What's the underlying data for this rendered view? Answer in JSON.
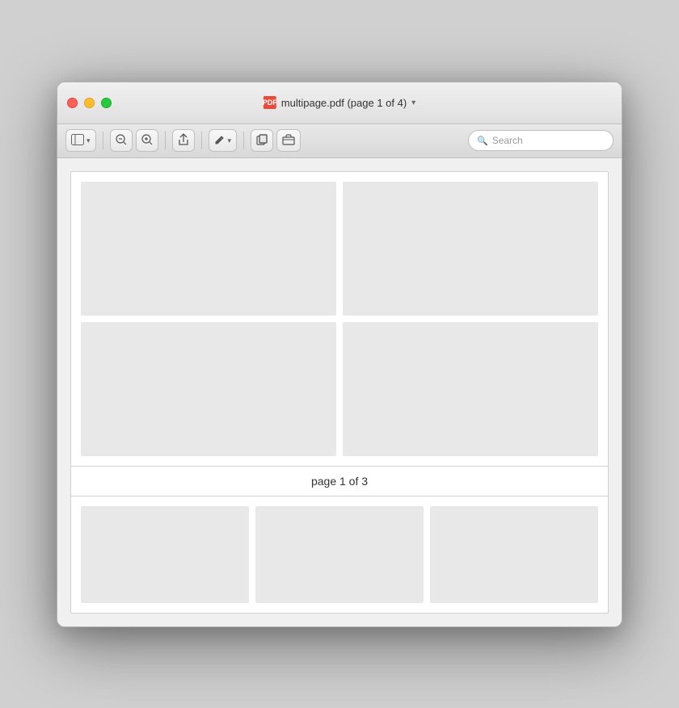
{
  "window": {
    "title": "multipage.pdf (page 1 of 4)",
    "title_icon_text": "PDF"
  },
  "toolbar": {
    "sidebar_toggle": "⊞",
    "zoom_out": "−",
    "zoom_in": "+",
    "share": "↑",
    "annotate": "✏",
    "annotate_chevron": "▾",
    "copy": "⧉",
    "toolbox": "⊡",
    "search_placeholder": "Search"
  },
  "content": {
    "page_label": "page 1 of 3",
    "grid_top": {
      "cells": [
        "",
        "",
        "",
        ""
      ]
    },
    "grid_bottom": {
      "cells": [
        "",
        "",
        ""
      ]
    }
  }
}
